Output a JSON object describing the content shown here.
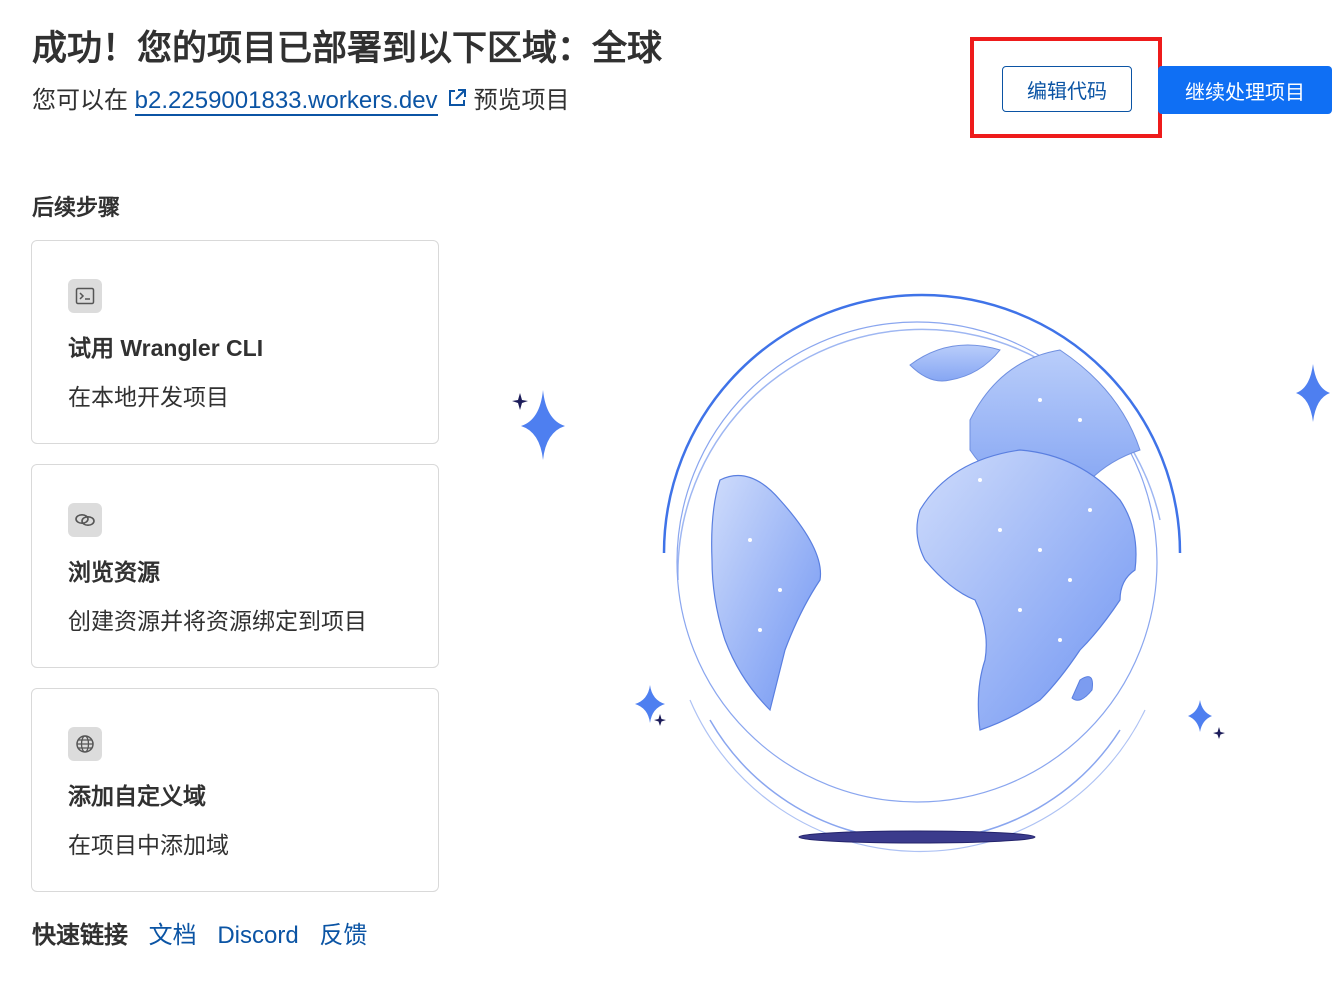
{
  "header": {
    "title": "成功！您的项目已部署到以下区域：全球",
    "subtitle_prefix": "您可以在",
    "preview_link": "b2.2259001833.workers.dev",
    "subtitle_suffix": "预览项目"
  },
  "actions": {
    "edit_code": "编辑代码",
    "continue": "继续处理项目"
  },
  "next_steps": {
    "title": "后续步骤",
    "cards": [
      {
        "icon": "terminal-icon",
        "title": "试用 Wrangler CLI",
        "desc": "在本地开发项目"
      },
      {
        "icon": "link-icon",
        "title": "浏览资源",
        "desc": "创建资源并将资源绑定到项目"
      },
      {
        "icon": "globe-icon",
        "title": "添加自定义域",
        "desc": "在项目中添加域"
      }
    ]
  },
  "quick_links": {
    "label": "快速链接",
    "docs": "文档",
    "discord": "Discord",
    "feedback": "反馈"
  },
  "colors": {
    "primary": "#0f6ff4",
    "link": "#0b54a4",
    "highlight": "#ee1b1b"
  }
}
